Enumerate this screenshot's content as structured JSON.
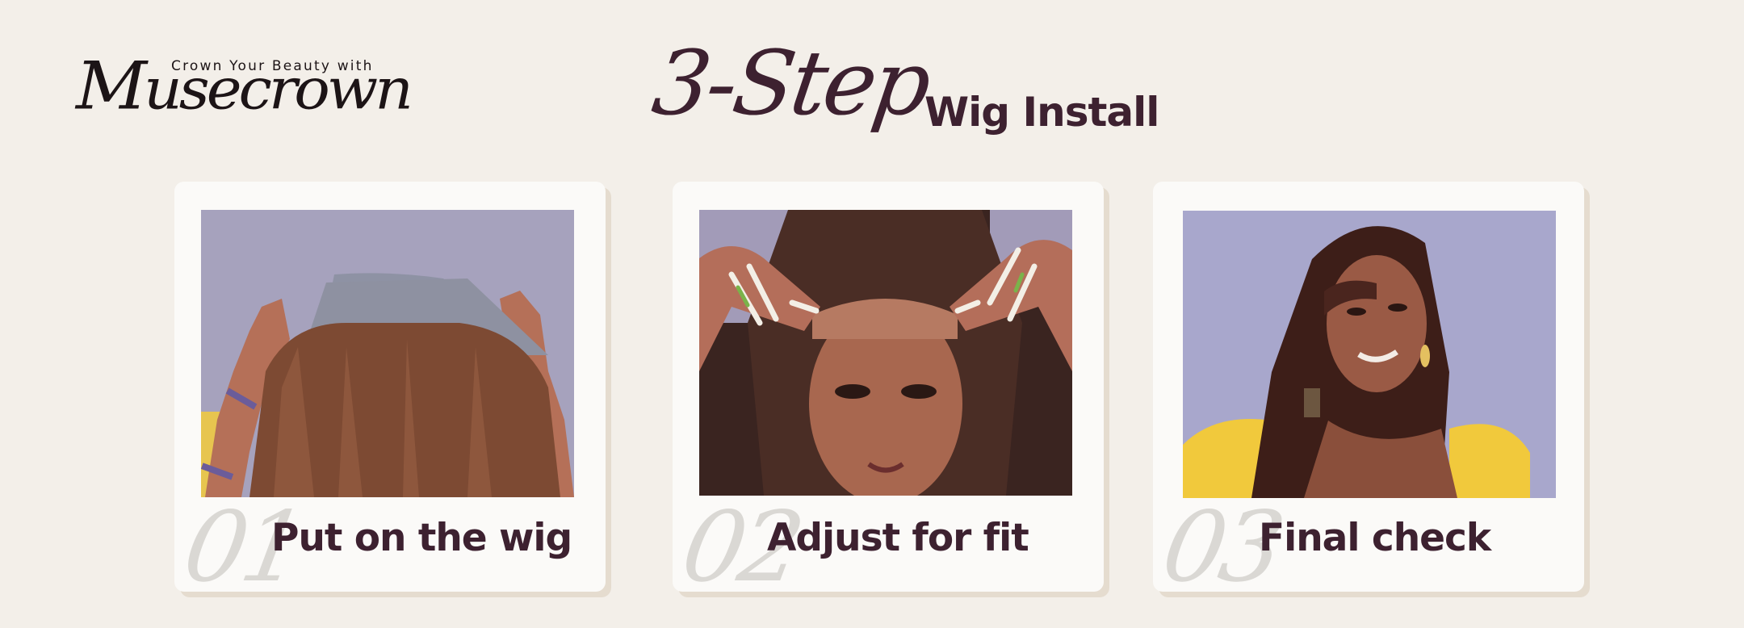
{
  "brand": {
    "tagline": "Crown Your Beauty with",
    "name": "Musecrown"
  },
  "headline": {
    "script": "3-Step",
    "sub": "Wig Install"
  },
  "steps": [
    {
      "number": "01",
      "label": "Put on the wig",
      "photo_icon": "wig-back-photo-icon"
    },
    {
      "number": "02",
      "label": "Adjust for fit",
      "photo_icon": "wig-adjust-photo-icon"
    },
    {
      "number": "03",
      "label": "Final check",
      "photo_icon": "wig-final-photo-icon"
    }
  ],
  "colors": {
    "background": "#f3efe9",
    "card": "#fbfaf8",
    "card_shadow": "#e5dccf",
    "text_dark": "#3d2130",
    "step_number": "#dad8d4",
    "photo_backdrop": "#a7a3c0"
  }
}
